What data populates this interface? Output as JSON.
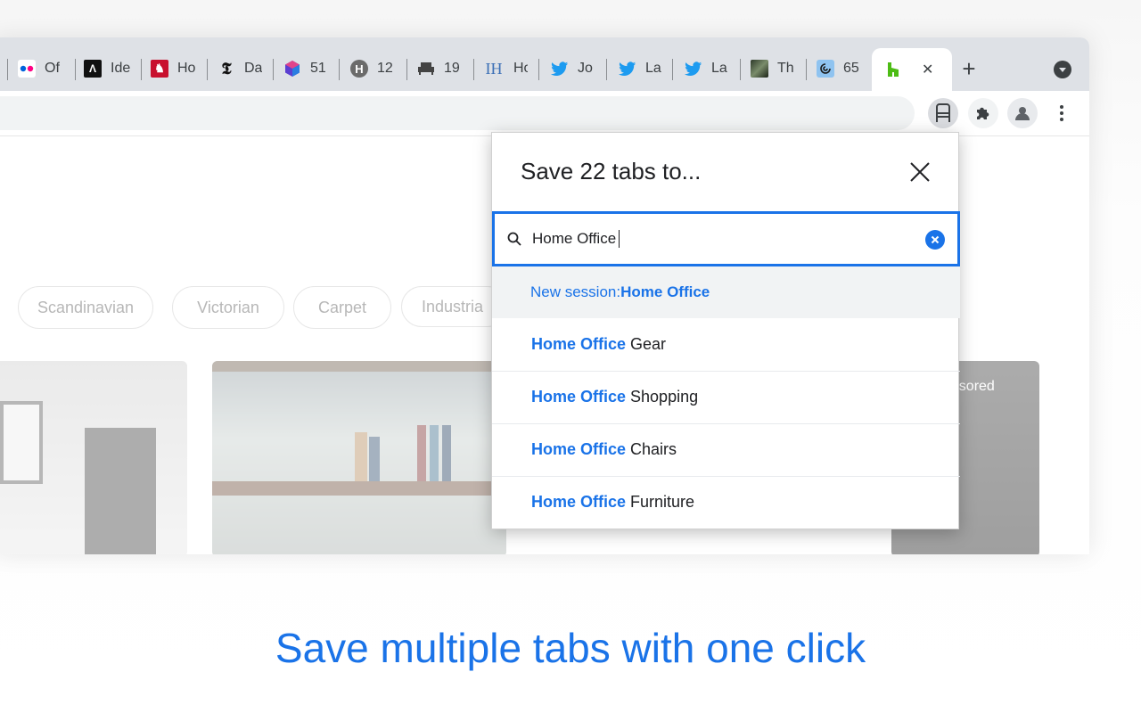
{
  "tabs": [
    {
      "title": "Of",
      "icon": "flickr-icon"
    },
    {
      "title": "Ide",
      "icon": "ideo-icon"
    },
    {
      "title": "Ho",
      "icon": "rooster-icon"
    },
    {
      "title": "Da",
      "icon": "nytimes-icon"
    },
    {
      "title": "51",
      "icon": "cube-icon"
    },
    {
      "title": "12",
      "icon": "houzz-h-icon"
    },
    {
      "title": "19",
      "icon": "sofa-icon"
    },
    {
      "title": "Ho",
      "icon": "ih-icon"
    },
    {
      "title": "Jo",
      "icon": "twitter-icon"
    },
    {
      "title": "La",
      "icon": "twitter-icon"
    },
    {
      "title": "La",
      "icon": "twitter-icon"
    },
    {
      "title": "Th",
      "icon": "photo-icon"
    },
    {
      "title": "65",
      "icon": "swirl-icon"
    }
  ],
  "active_tab": {
    "icon": "houzz-icon",
    "close": "✕"
  },
  "new_tab_label": "+",
  "page": {
    "filters": [
      "Scandinavian",
      "Victorian",
      "Carpet",
      "Industria"
    ],
    "sponsored_label": "onsored"
  },
  "popup": {
    "title": "Save 22 tabs to...",
    "search_value": "Home Office",
    "new_session_prefix": "New session: ",
    "new_session_name": "Home Office",
    "suggestions": [
      {
        "match": "Home Office",
        "rest": " Gear"
      },
      {
        "match": "Home Office",
        "rest": " Shopping"
      },
      {
        "match": "Home Office",
        "rest": " Chairs"
      },
      {
        "match": "Home Office",
        "rest": " Furniture"
      }
    ]
  },
  "caption": "Save multiple tabs with one click",
  "colors": {
    "accent": "#1a73e8",
    "tabstrip": "#dee1e6"
  }
}
